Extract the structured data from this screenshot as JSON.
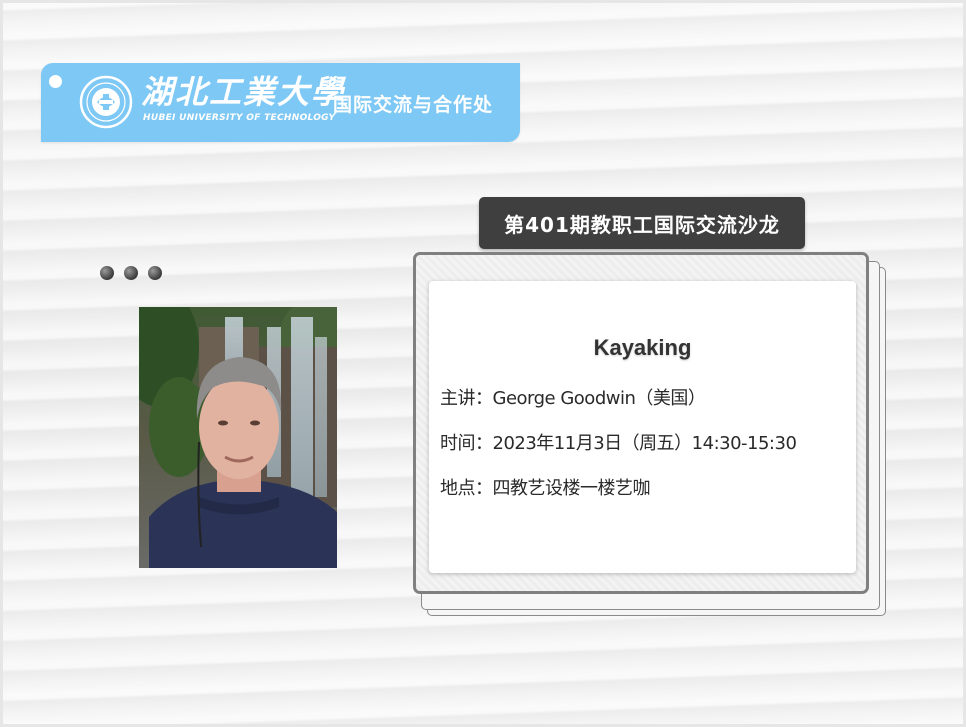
{
  "header": {
    "university_cn": "湖北工業大學",
    "university_en": "HUBEI UNIVERSITY OF TECHNOLOGY",
    "department": "国际交流与合作处",
    "logo_icon": "university-seal-icon",
    "accent_color": "#7ec8f5"
  },
  "session": {
    "badge": "第401期教职工国际交流沙龙"
  },
  "talk": {
    "title": "Kayaking",
    "speaker_label": "主讲：",
    "speaker": "George Goodwin（美国）",
    "time_label": "时间：",
    "time": "2023年11月3日（周五）14:30-15:30",
    "place_label": "地点：",
    "place": "四教艺设楼一楼艺咖"
  },
  "decor": {
    "dots_icon": "three-dots-icon",
    "photo": "speaker-photo"
  }
}
